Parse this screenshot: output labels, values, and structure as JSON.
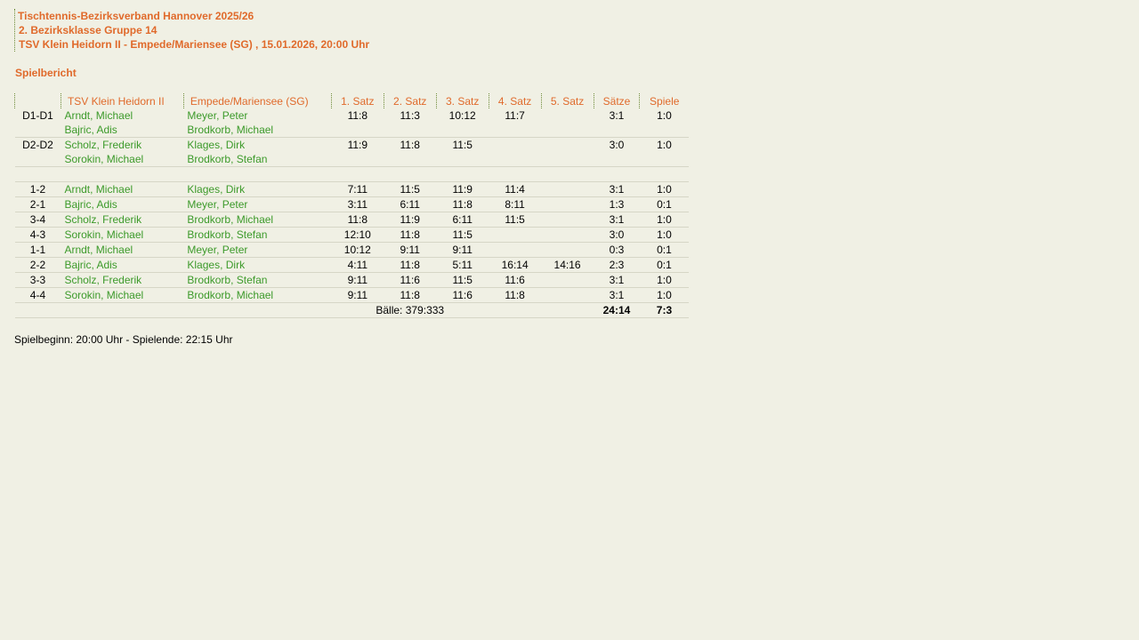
{
  "header": {
    "line1": "Tischtennis-Bezirksverband Hannover 2025/26",
    "line2": "2. Bezirksklasse Gruppe 14",
    "line3": "TSV Klein Heidorn II - Empede/Mariensee (SG) , 15.01.2026, 20:00 Uhr"
  },
  "report_title": "Spielbericht",
  "table": {
    "columns": {
      "pos": "",
      "home": "TSV Klein Heidorn II",
      "guest": "Empede/Mariensee (SG)",
      "s1": "1. Satz",
      "s2": "2. Satz",
      "s3": "3. Satz",
      "s4": "4. Satz",
      "s5": "5. Satz",
      "saetze": "Sätze",
      "spiele": "Spiele"
    },
    "doubles": [
      {
        "pos": "D1-D1",
        "home1": "Arndt, Michael",
        "home2": "Bajric, Adis",
        "guest1": "Meyer, Peter",
        "guest2": "Brodkorb, Michael",
        "s1": "11:8",
        "s2": "11:3",
        "s3": "10:12",
        "s4": "11:7",
        "s5": "",
        "saetze": "3:1",
        "spiele": "1:0"
      },
      {
        "pos": "D2-D2",
        "home1": "Scholz, Frederik",
        "home2": "Sorokin, Michael",
        "guest1": "Klages, Dirk",
        "guest2": "Brodkorb, Stefan",
        "s1": "11:9",
        "s2": "11:8",
        "s3": "11:5",
        "s4": "",
        "s5": "",
        "saetze": "3:0",
        "spiele": "1:0"
      }
    ],
    "singles": [
      {
        "pos": "1-2",
        "home": "Arndt, Michael",
        "guest": "Klages, Dirk",
        "s1": "7:11",
        "s2": "11:5",
        "s3": "11:9",
        "s4": "11:4",
        "s5": "",
        "saetze": "3:1",
        "spiele": "1:0"
      },
      {
        "pos": "2-1",
        "home": "Bajric, Adis",
        "guest": "Meyer, Peter",
        "s1": "3:11",
        "s2": "6:11",
        "s3": "11:8",
        "s4": "8:11",
        "s5": "",
        "saetze": "1:3",
        "spiele": "0:1"
      },
      {
        "pos": "3-4",
        "home": "Scholz, Frederik",
        "guest": "Brodkorb, Michael",
        "s1": "11:8",
        "s2": "11:9",
        "s3": "6:11",
        "s4": "11:5",
        "s5": "",
        "saetze": "3:1",
        "spiele": "1:0"
      },
      {
        "pos": "4-3",
        "home": "Sorokin, Michael",
        "guest": "Brodkorb, Stefan",
        "s1": "12:10",
        "s2": "11:8",
        "s3": "11:5",
        "s4": "",
        "s5": "",
        "saetze": "3:0",
        "spiele": "1:0"
      },
      {
        "pos": "1-1",
        "home": "Arndt, Michael",
        "guest": "Meyer, Peter",
        "s1": "10:12",
        "s2": "9:11",
        "s3": "9:11",
        "s4": "",
        "s5": "",
        "saetze": "0:3",
        "spiele": "0:1"
      },
      {
        "pos": "2-2",
        "home": "Bajric, Adis",
        "guest": "Klages, Dirk",
        "s1": "4:11",
        "s2": "11:8",
        "s3": "5:11",
        "s4": "16:14",
        "s5": "14:16",
        "saetze": "2:3",
        "spiele": "0:1"
      },
      {
        "pos": "3-3",
        "home": "Scholz, Frederik",
        "guest": "Brodkorb, Stefan",
        "s1": "9:11",
        "s2": "11:6",
        "s3": "11:5",
        "s4": "11:6",
        "s5": "",
        "saetze": "3:1",
        "spiele": "1:0"
      },
      {
        "pos": "4-4",
        "home": "Sorokin, Michael",
        "guest": "Brodkorb, Michael",
        "s1": "9:11",
        "s2": "11:8",
        "s3": "11:6",
        "s4": "11:8",
        "s5": "",
        "saetze": "3:1",
        "spiele": "1:0"
      }
    ],
    "summary": {
      "balls": "Bälle: 379:333",
      "saetze": "24:14",
      "spiele": "7:3"
    }
  },
  "footer": "Spielbeginn: 20:00 Uhr - Spielende: 22:15 Uhr"
}
